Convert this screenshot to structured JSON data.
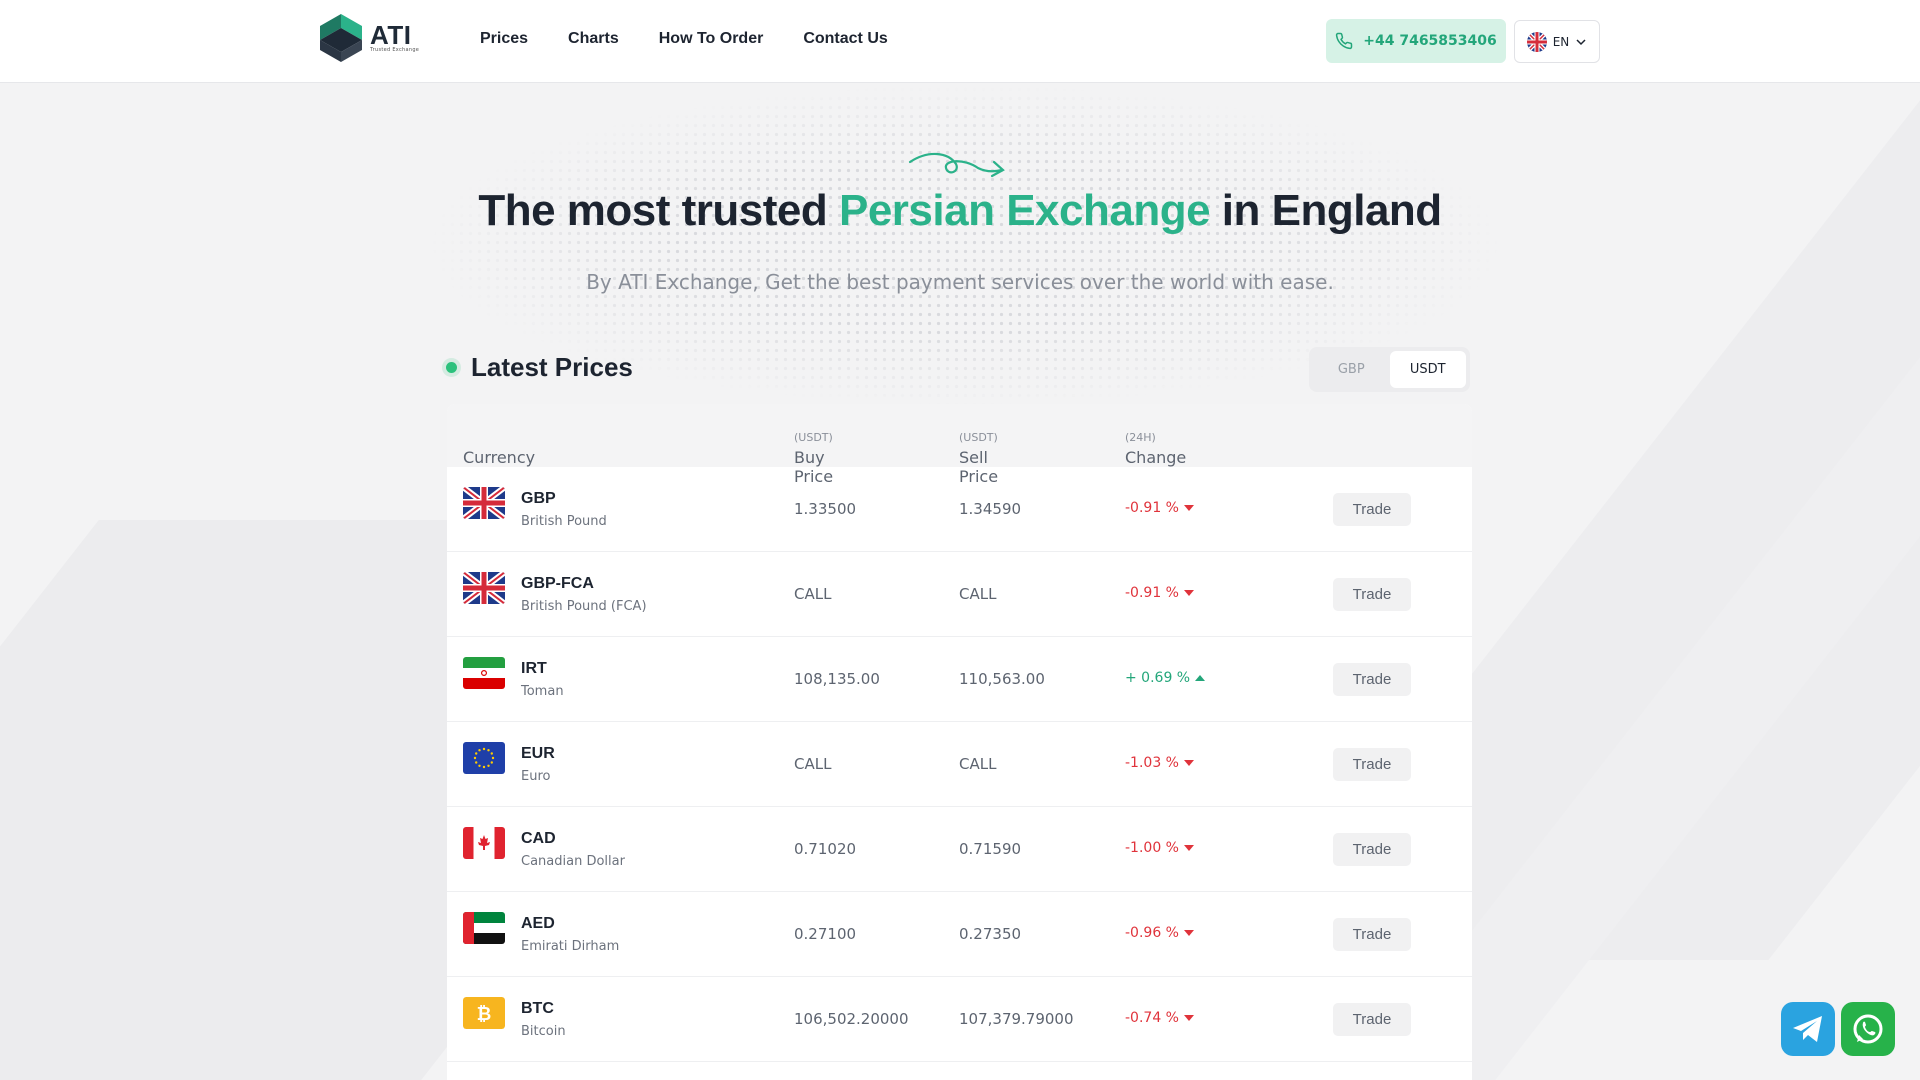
{
  "brand": {
    "name": "ATI",
    "tagline": "Trusted Exchange",
    "accent_color": "#2bb28a"
  },
  "nav": {
    "items": [
      "Prices",
      "Charts",
      "How To Order",
      "Contact Us"
    ]
  },
  "header": {
    "phone": "+44 7465853406",
    "language": "EN"
  },
  "hero": {
    "title_pre": "The most trusted ",
    "title_accent": "Persian Exchange",
    "title_post": " in England",
    "subtitle": "By ATI Exchange, Get the best payment services over the world with ease."
  },
  "prices": {
    "heading": "Latest Prices",
    "toggle": [
      "GBP",
      "USDT"
    ],
    "toggle_active": "USDT",
    "columns": {
      "currency": "Currency",
      "buy": "Buy Price",
      "sell": "Sell Price",
      "change": "Change",
      "unit": "(USDT)",
      "period": "(24H)"
    },
    "trade_label": "Trade",
    "rows": [
      {
        "code": "GBP",
        "name": "British Pound",
        "buy": "1.33500",
        "sell": "1.34590",
        "change": "-0.91 %",
        "dir": "down",
        "flag": "uk-flag-icon"
      },
      {
        "code": "GBP-FCA",
        "name": "British Pound (FCA)",
        "buy": "CALL",
        "sell": "CALL",
        "change": "-0.91 %",
        "dir": "down",
        "flag": "uk-flag-icon"
      },
      {
        "code": "IRT",
        "name": "Toman",
        "buy": "108,135.00",
        "sell": "110,563.00",
        "change": "+ 0.69 %",
        "dir": "up",
        "flag": "iran-flag-icon"
      },
      {
        "code": "EUR",
        "name": "Euro",
        "buy": "CALL",
        "sell": "CALL",
        "change": "-1.03 %",
        "dir": "down",
        "flag": "eu-flag-icon"
      },
      {
        "code": "CAD",
        "name": "Canadian Dollar",
        "buy": "0.71020",
        "sell": "0.71590",
        "change": "-1.00 %",
        "dir": "down",
        "flag": "canada-flag-icon"
      },
      {
        "code": "AED",
        "name": "Emirati Dirham",
        "buy": "0.27100",
        "sell": "0.27350",
        "change": "-0.96 %",
        "dir": "down",
        "flag": "uae-flag-icon"
      },
      {
        "code": "BTC",
        "name": "Bitcoin",
        "buy": "106,502.20000",
        "sell": "107,379.79000",
        "change": "-0.74 %",
        "dir": "down",
        "flag": "bitcoin-icon"
      }
    ]
  },
  "floating": {
    "telegram": "telegram-icon",
    "whatsapp": "whatsapp-icon"
  }
}
